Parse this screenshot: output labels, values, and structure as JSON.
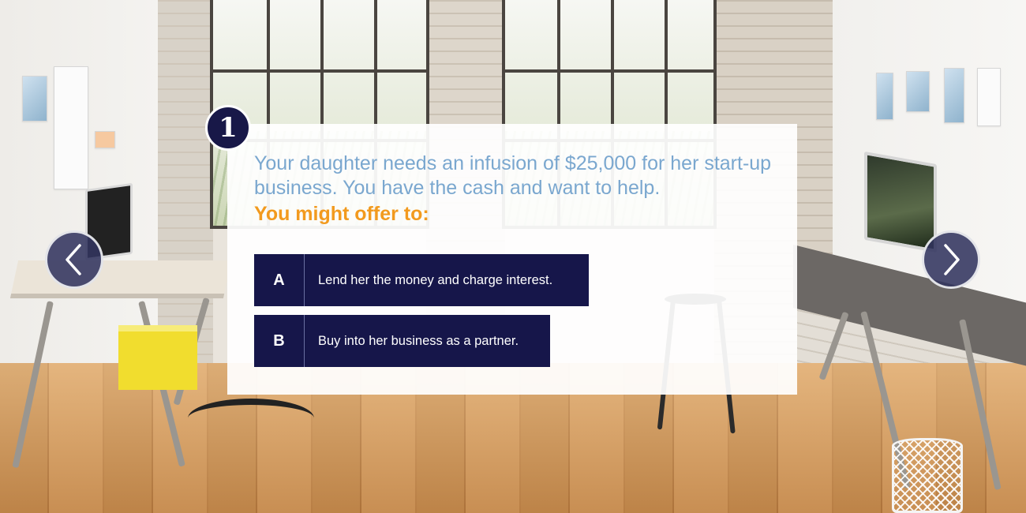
{
  "question": {
    "number": "1",
    "text": "Your daughter needs an infusion of $25,000 for her start-up business. You have the cash and want to help.",
    "prompt": "You might offer to:"
  },
  "answers": [
    {
      "letter": "A",
      "text": "Lend her the money and charge interest."
    },
    {
      "letter": "B",
      "text": "Buy into her business as a partner."
    }
  ],
  "navigation": {
    "prev_icon": "chevron-left-icon",
    "next_icon": "chevron-right-icon"
  },
  "colors": {
    "navy": "#16164a",
    "question_blue": "#7aa7cf",
    "prompt_orange": "#f29a1e"
  }
}
